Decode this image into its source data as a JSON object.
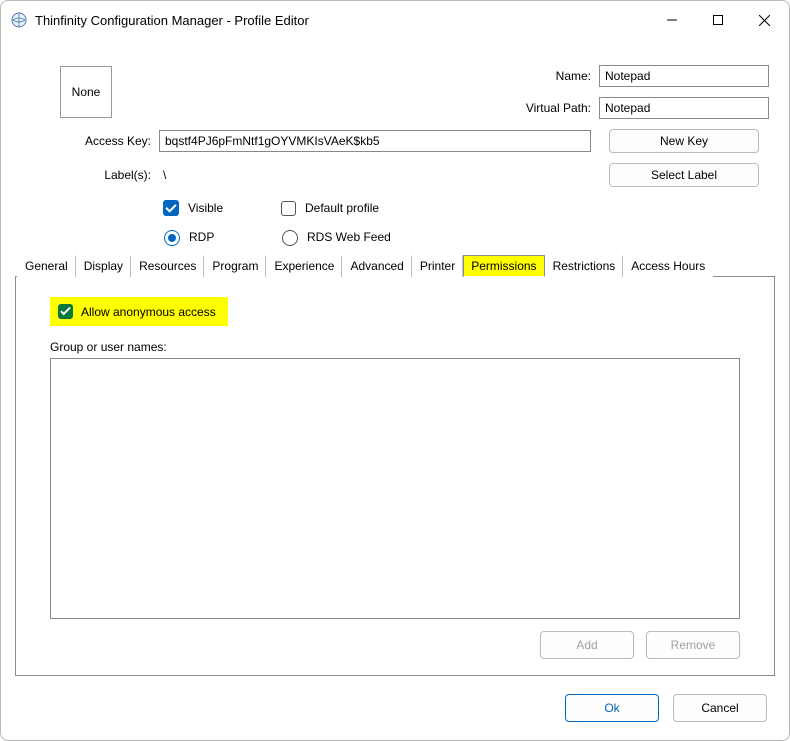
{
  "window": {
    "title": "Thinfinity Configuration Manager - Profile Editor"
  },
  "form": {
    "name_label": "Name:",
    "name_value": "Notepad",
    "virtual_path_label": "Virtual Path:",
    "virtual_path_value": "Notepad",
    "access_key_label": "Access Key:",
    "access_key_value": "bqstf4PJ6pFmNtf1gOYVMKIsVAeK$kb5",
    "labels_label": "Label(s):",
    "labels_value": "\\",
    "icon_text": "None",
    "new_key_btn": "New Key",
    "select_label_btn": "Select Label"
  },
  "options": {
    "visible_label": "Visible",
    "visible_checked": true,
    "default_profile_label": "Default profile",
    "default_profile_checked": false,
    "rdp_label": "RDP",
    "rds_label": "RDS Web Feed",
    "protocol_selected": "rdp"
  },
  "tabs": {
    "items": [
      {
        "label": "General"
      },
      {
        "label": "Display"
      },
      {
        "label": "Resources"
      },
      {
        "label": "Program"
      },
      {
        "label": "Experience"
      },
      {
        "label": "Advanced"
      },
      {
        "label": "Printer"
      },
      {
        "label": "Permissions"
      },
      {
        "label": "Restrictions"
      },
      {
        "label": "Access Hours"
      }
    ],
    "active_index": 7
  },
  "permissions": {
    "allow_anonymous_label": "Allow anonymous access",
    "allow_anonymous_checked": true,
    "group_label": "Group or user names:",
    "add_btn": "Add",
    "remove_btn": "Remove"
  },
  "dialog": {
    "ok_btn": "Ok",
    "cancel_btn": "Cancel"
  }
}
